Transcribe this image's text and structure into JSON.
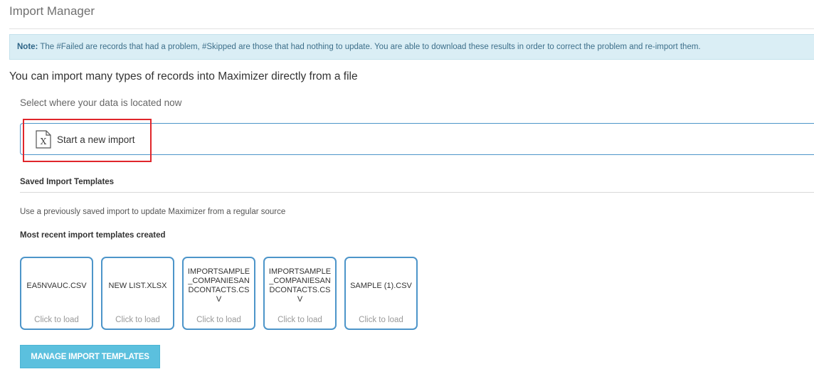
{
  "page": {
    "title": "Import Manager"
  },
  "note": {
    "label": "Note:",
    "text": " The #Failed are records that had a problem, #Skipped are those that had nothing to update. You are able to download these results in order to correct the problem and re-import them."
  },
  "headline": "You can import many types of records into Maximizer directly from a file",
  "data_location": {
    "prompt": "Select where your data is located now",
    "start_import_label": "Start a new import",
    "icon": "excel-file-icon"
  },
  "saved_templates": {
    "heading": "Saved Import Templates",
    "description": "Use a previously saved import to update Maximizer from a regular source",
    "recent_heading": "Most recent import templates created",
    "load_label": "Click to load",
    "templates": [
      {
        "name": "EA5NVAUC.CSV"
      },
      {
        "name": "NEW LIST.XLSX"
      },
      {
        "name": "IMPORTSAMPLE_COMPANIESANDCONTACTS.CSV"
      },
      {
        "name": "IMPORTSAMPLE_COMPANIESANDCONTACTS.CSV"
      },
      {
        "name": "SAMPLE (1).CSV"
      }
    ],
    "manage_button": "MANAGE IMPORT TEMPLATES"
  },
  "colors": {
    "accent": "#4d95c9",
    "highlight": "#e0262b",
    "note_bg": "#daeef5",
    "button_bg": "#5bc0de"
  }
}
